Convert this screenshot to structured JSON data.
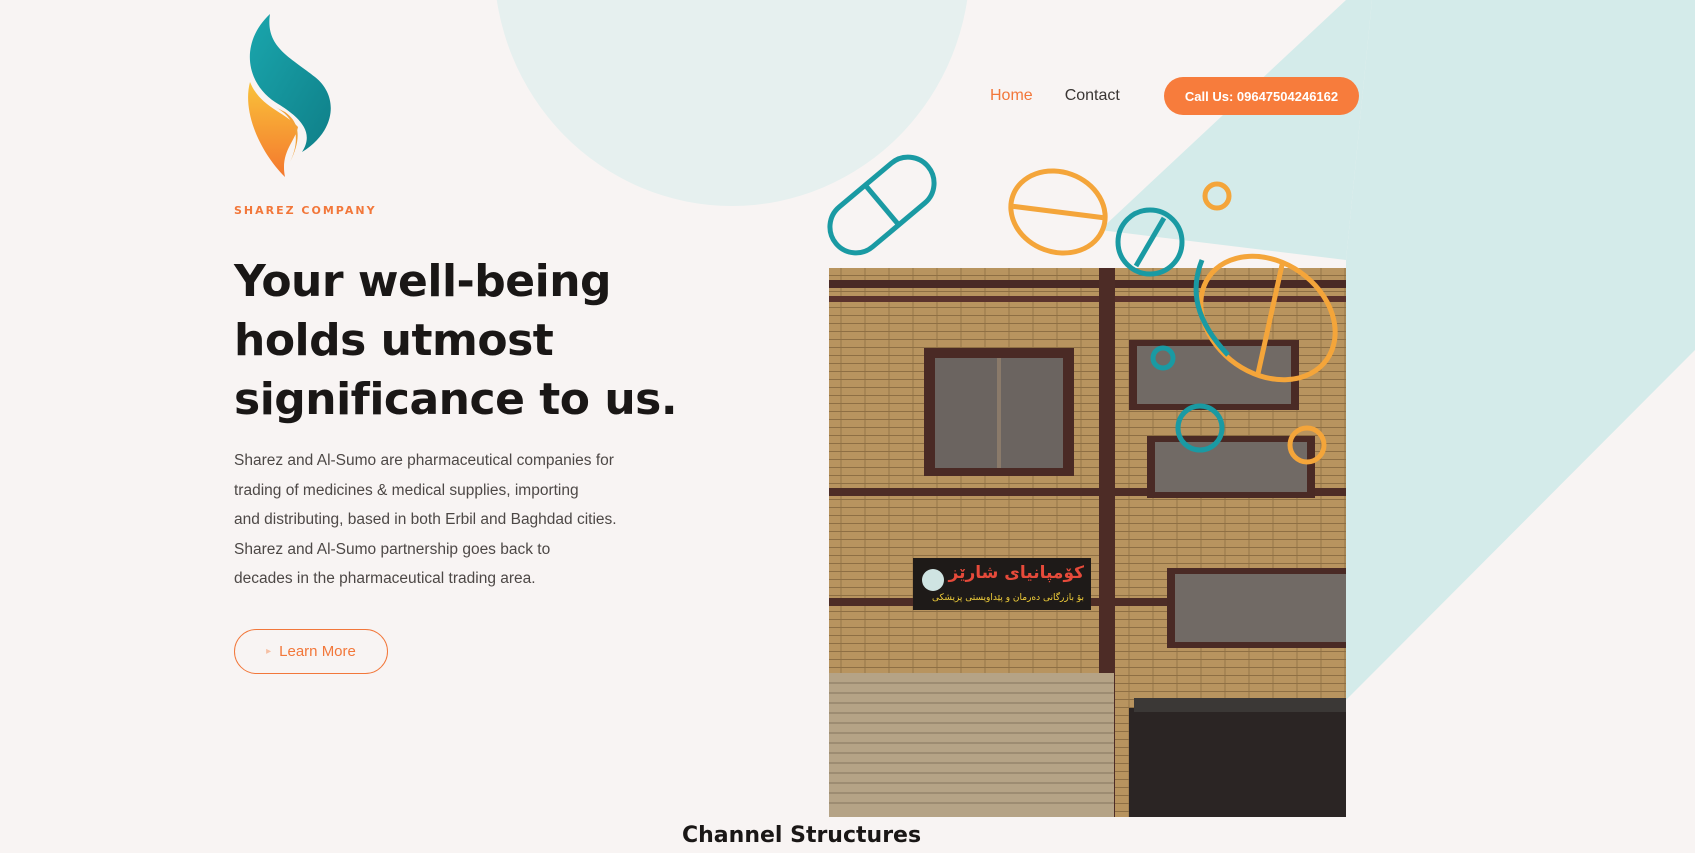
{
  "brand": {
    "name": "SHAREZ COMPANY"
  },
  "nav": {
    "items": [
      {
        "label": "Home",
        "active": true
      },
      {
        "label": "Contact",
        "active": false
      }
    ],
    "call_button": "Call Us: 09647504246162"
  },
  "hero": {
    "headline_lines": [
      "Your well-being",
      "holds utmost",
      "significance to us."
    ],
    "description_lines": [
      "Sharez and Al-Sumo are pharmaceutical companies for",
      "trading of medicines & medical supplies, importing",
      "and distributing, based in both Erbil and Baghdad cities.",
      "Sharez and Al-Sumo partnership goes back to",
      "decades in the pharmaceutical trading area."
    ],
    "learn_more": "Learn More",
    "sign_text": "کۆمپانیای شارێز",
    "sign_subtext": "بۆ بازرگانی دەرمان و پێداویستی پزیشکی"
  },
  "section": {
    "title": "Channel Structures"
  },
  "colors": {
    "accent": "#f2773a",
    "teal": "#1a9aa3",
    "orange_pill": "#f4a53a",
    "background": "#f8f4f3",
    "diagonal": "#d4ebea"
  }
}
